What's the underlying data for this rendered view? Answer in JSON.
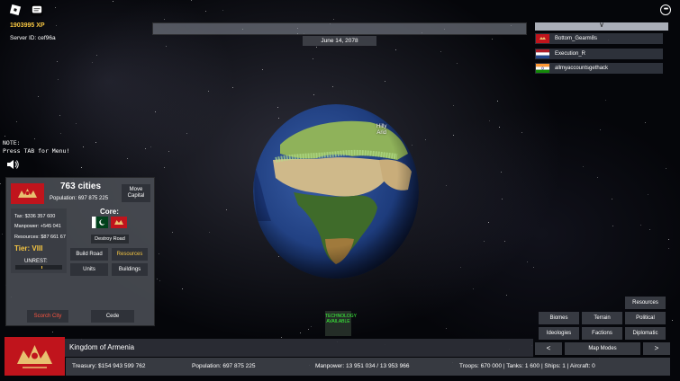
{
  "hud": {
    "xp": "1903995 XP",
    "server_id": "Server ID: cef96a",
    "note": "NOTE:\nPress TAB for Menu!",
    "date": "June 14, 2078",
    "hover_label_line1": "Hilly",
    "hover_label_line2": "Arid"
  },
  "players": {
    "header": "V",
    "list": [
      {
        "name": "Bottom_Gearm8s"
      },
      {
        "name": "Execution_R"
      },
      {
        "name": "allmyaccountsgethack"
      }
    ]
  },
  "country_panel": {
    "cities": "763 cities",
    "population": "Population: 697 875 225",
    "move_capital": "Move Capital",
    "tax": "Tax: $336 357 600",
    "manpower": "Manpower: +545 041",
    "resources": "Resources: $87 661 67",
    "tier": "Tier: VIII",
    "unrest_label": "UNREST:",
    "unrest_level": 0.55,
    "core_label": "Core:",
    "destroy_road": "Destroy Road",
    "build_road": "Build Road",
    "resources_button": "Resources",
    "units": "Units",
    "buildings": "Buildings",
    "scorch_city": "Scorch City",
    "cede": "Cede"
  },
  "technology_notice": "TECHNOLOGY AVAILABLE",
  "map_modes": {
    "resources": "Resources",
    "biomes": "Biomes",
    "terrain": "Terrain",
    "political": "Political",
    "ideologies": "Ideologies",
    "factions": "Factions",
    "diplomatic": "Diplomatic",
    "prev": "<",
    "label": "Map Modes",
    "next": ">"
  },
  "bottom": {
    "country_name": "Kingdom of Armenia",
    "treasury": "Treasury:  $154 943 599 762",
    "population": "Population:  697 875 225",
    "manpower": "Manpower:  13 951 034  /  13 953 966",
    "military": "Troops: 670 000  |  Tanks: 1 600  |  Ships: 1  |  Aircraft: 0"
  },
  "colors": {
    "accent_gold": "#f5c542",
    "danger_red": "#ff5540",
    "tech_green": "#3cff3c",
    "flag_red": "#c0141c"
  }
}
